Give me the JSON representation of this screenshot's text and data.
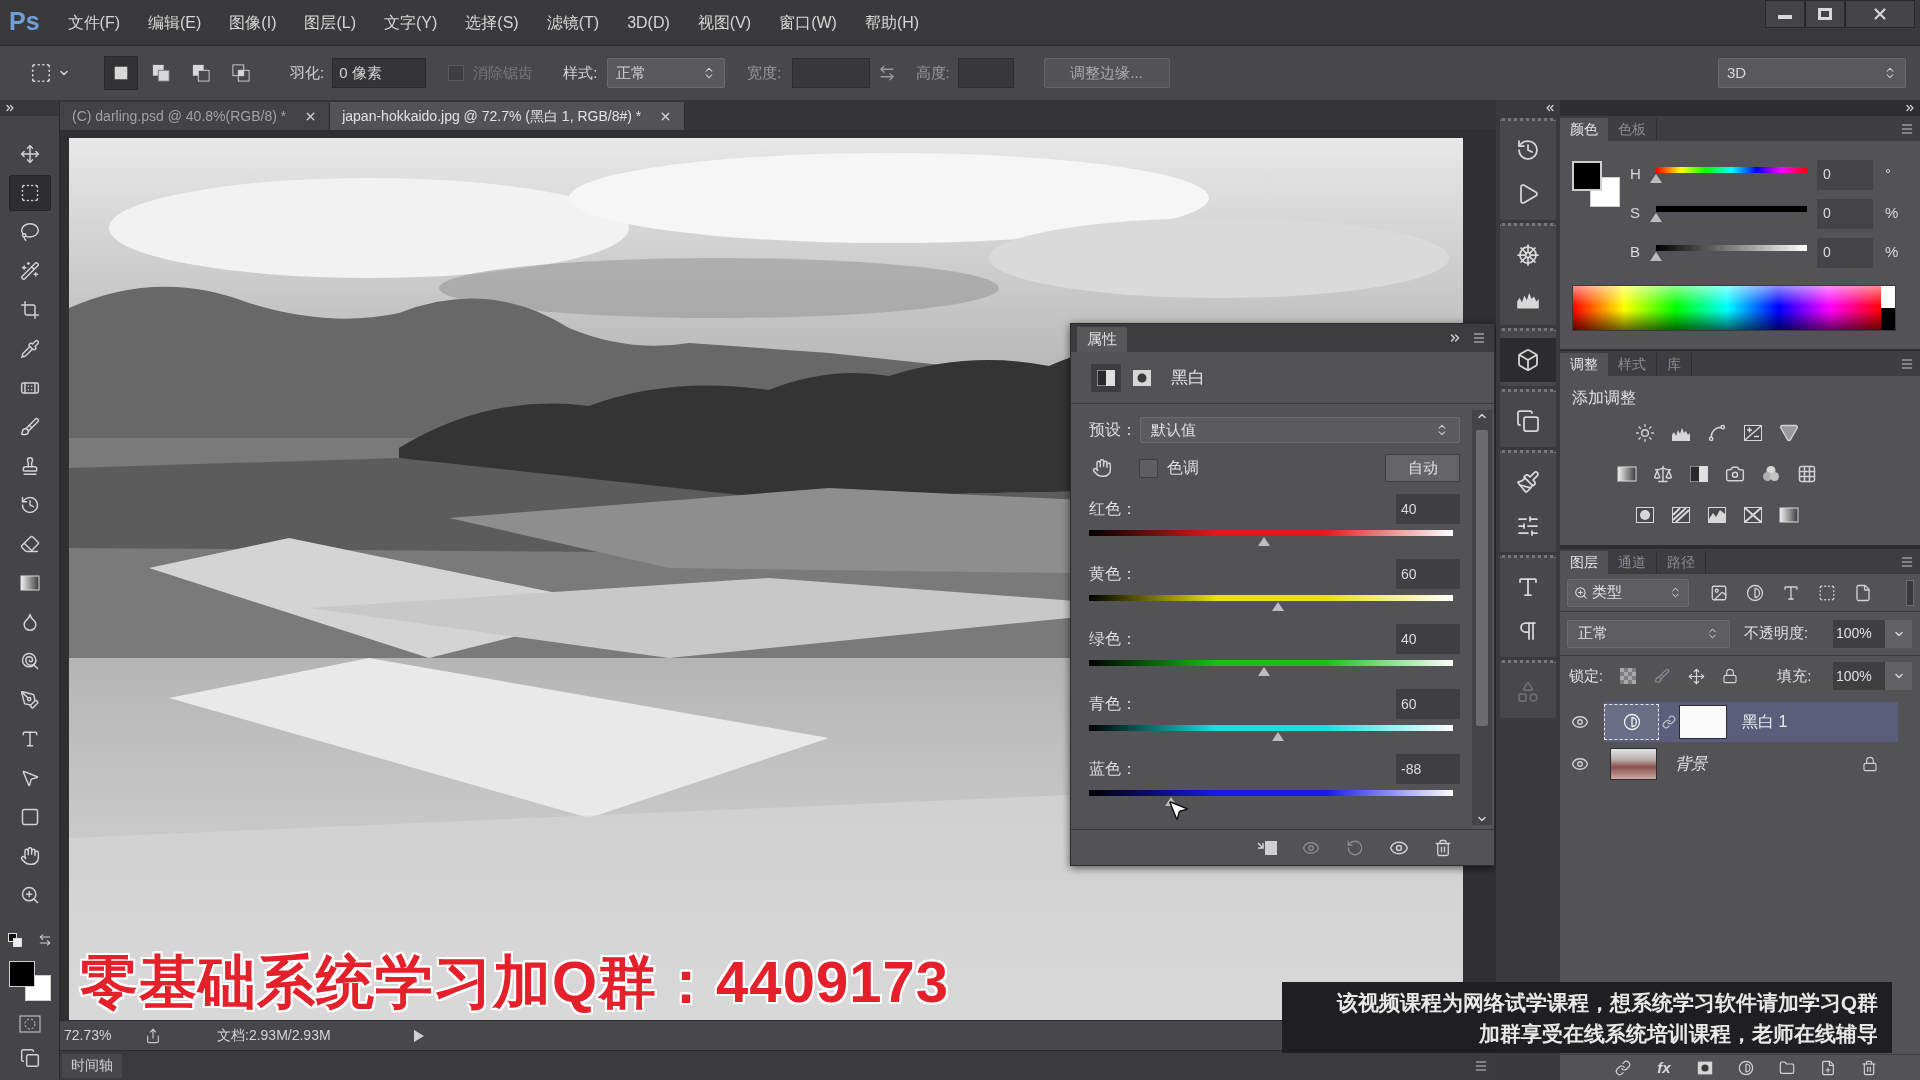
{
  "menu_bar": {
    "logo": "Ps",
    "items": [
      "文件(F)",
      "编辑(E)",
      "图像(I)",
      "图层(L)",
      "文字(Y)",
      "选择(S)",
      "滤镜(T)",
      "3D(D)",
      "视图(V)",
      "窗口(W)",
      "帮助(H)"
    ]
  },
  "options_bar": {
    "selection_modes": [
      {
        "selected": true
      },
      {
        "selected": false
      },
      {
        "selected": false
      },
      {
        "selected": false
      }
    ],
    "feather_label": "羽化:",
    "feather_value": "0 像素",
    "anti_alias": {
      "label": "消除锯齿",
      "checked": false,
      "disabled": true
    },
    "style_label": "样式:",
    "style_value": "正常",
    "width_label": "宽度:",
    "height_label": "高度:",
    "refine_edge_button": "调整边缘...",
    "workspace": "3D"
  },
  "document_tabs": [
    {
      "label": "(C) darling.psd @ 40.8%(RGB/8) *",
      "selected": false
    },
    {
      "label": "japan-hokkaido.jpg @ 72.7% (黑白 1, RGB/8#) *",
      "selected": true
    }
  ],
  "tools": [
    {
      "selected": false
    },
    {
      "selected": true
    },
    {
      "selected": false
    },
    {
      "selected": false
    },
    {
      "selected": false
    },
    {
      "selected": false
    },
    {
      "selected": false
    },
    {
      "selected": false
    },
    {
      "selected": false
    },
    {
      "selected": false
    },
    {
      "selected": false
    },
    {
      "selected": false
    },
    {
      "selected": false
    },
    {
      "selected": false
    },
    {
      "selected": false
    },
    {
      "selected": false
    },
    {
      "selected": false
    },
    {
      "selected": false
    },
    {
      "selected": false
    },
    {
      "selected": false
    }
  ],
  "tool_swatches": [
    {
      "color": "#000000"
    },
    {
      "color": "#ffffff"
    }
  ],
  "properties_panel": {
    "tab": "属性",
    "title": "黑白",
    "preset_label": "预设：",
    "preset_value": "默认值",
    "tint": {
      "label": "色调",
      "checked": false
    },
    "auto_button": "自动",
    "sliders": [
      {
        "label": "红色：",
        "value": "40",
        "level": 0.48,
        "color": "#e01b1b"
      },
      {
        "label": "黄色：",
        "value": "60",
        "level": 0.52,
        "color": "#e8e010"
      },
      {
        "label": "绿色：",
        "value": "40",
        "level": 0.48,
        "color": "#18c018"
      },
      {
        "label": "青色：",
        "value": "60",
        "level": 0.52,
        "color": "#18e0e0"
      },
      {
        "label": "蓝色：",
        "value": "-88",
        "level": 0.224,
        "color": "#1818e8"
      }
    ]
  },
  "status_bar": {
    "zoom": "72.73%",
    "document_info": "文档:2.93M/2.93M"
  },
  "timeline": {
    "label": "时间轴"
  },
  "dock_buttons": [
    {
      "selected": false,
      "disabled": false
    },
    {
      "selected": false,
      "disabled": false
    },
    {
      "selected": false,
      "disabled": false
    },
    {
      "selected": false,
      "disabled": false
    },
    {
      "selected": true,
      "disabled": false
    },
    {
      "selected": false,
      "disabled": false
    },
    {
      "selected": false,
      "disabled": false
    },
    {
      "selected": false,
      "disabled": false
    },
    {
      "selected": false,
      "disabled": false
    },
    {
      "selected": false,
      "disabled": false
    },
    {
      "selected": false,
      "disabled": true
    }
  ],
  "color_panel": {
    "tabs": [
      {
        "label": "颜色",
        "selected": true
      },
      {
        "label": "色板",
        "selected": false
      }
    ],
    "swatches": [
      {
        "color": "#000000"
      },
      {
        "color": "#ffffff"
      }
    ],
    "channels": [
      {
        "kind": "hue",
        "label": "H",
        "value": "0",
        "unit": "°",
        "level": 0
      },
      {
        "kind": "saturation",
        "label": "S",
        "value": "0",
        "unit": "%",
        "level": 0
      },
      {
        "kind": "brightness",
        "label": "B",
        "value": "0",
        "unit": "%",
        "level": 0
      }
    ]
  },
  "adjustments_panel": {
    "tabs": [
      {
        "label": "调整",
        "selected": true
      },
      {
        "label": "样式",
        "selected": false
      },
      {
        "label": "库",
        "selected": false
      }
    ],
    "heading": "添加调整"
  },
  "layers_panel": {
    "tabs": [
      {
        "label": "图层",
        "selected": true
      },
      {
        "label": "通道",
        "selected": false
      },
      {
        "label": "路径",
        "selected": false
      }
    ],
    "filter_value": "类型",
    "blend_mode": "正常",
    "opacity_label": "不透明度:",
    "opacity_value": "100%",
    "lock_label": "锁定:",
    "fill_label": "填充:",
    "fill_value": "100%",
    "layers": [
      {
        "kind": "adjustment",
        "name": "黑白 1",
        "visible": true,
        "selected": true,
        "locked": false
      },
      {
        "kind": "background",
        "name": "背景",
        "visible": true,
        "selected": false,
        "locked": true
      }
    ],
    "effects_button": "fx"
  },
  "video_overlays": {
    "caption": "零基础系统学习加Q群：4409173",
    "notice": [
      "该视频课程为网络试学课程，想系统学习软件请加学习Q群",
      "加群享受在线系统培训课程，老师在线辅导"
    ]
  }
}
